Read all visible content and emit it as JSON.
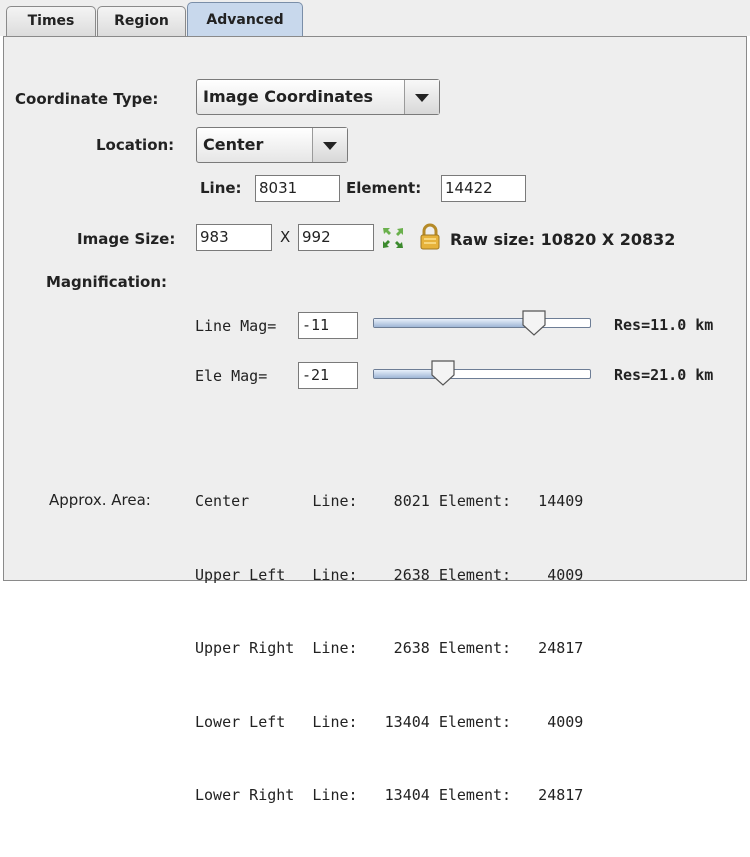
{
  "tabs": [
    {
      "label": "Times"
    },
    {
      "label": "Region"
    },
    {
      "label": "Advanced",
      "active": true
    }
  ],
  "coordinate_type": {
    "label": "Coordinate Type:",
    "value": "Image Coordinates"
  },
  "location": {
    "label": "Location:",
    "value": "Center"
  },
  "line_element": {
    "line_label": "Line:",
    "line_value": "8031",
    "element_label": "Element:",
    "element_value": "14422"
  },
  "image_size": {
    "label": "Image Size:",
    "width": "983",
    "sep": "X",
    "height": "992",
    "raw_size": "Raw size: 10820 X 20832"
  },
  "magnification": {
    "label": "Magnification:",
    "line_mag": {
      "label": "Line Mag=",
      "value": "-11",
      "res": "Res=11.0 km",
      "slider_fraction": 0.74
    },
    "ele_mag": {
      "label": "Ele  Mag=",
      "value": "-21",
      "res": "Res=21.0 km",
      "slider_fraction": 0.32
    }
  },
  "approx_area": {
    "label": "Approx. Area:",
    "rows": [
      "Center       Line:    8021 Element:   14409",
      "Upper Left   Line:    2638 Element:    4009",
      "Upper Right  Line:    2638 Element:   24817",
      "Lower Left   Line:   13404 Element:    4009",
      "Lower Right  Line:   13404 Element:   24817"
    ]
  },
  "colors": {
    "active_tab": "#c8d8ec",
    "slider_fill": "#9fb6d6",
    "panel_bg": "#eeeeee"
  }
}
